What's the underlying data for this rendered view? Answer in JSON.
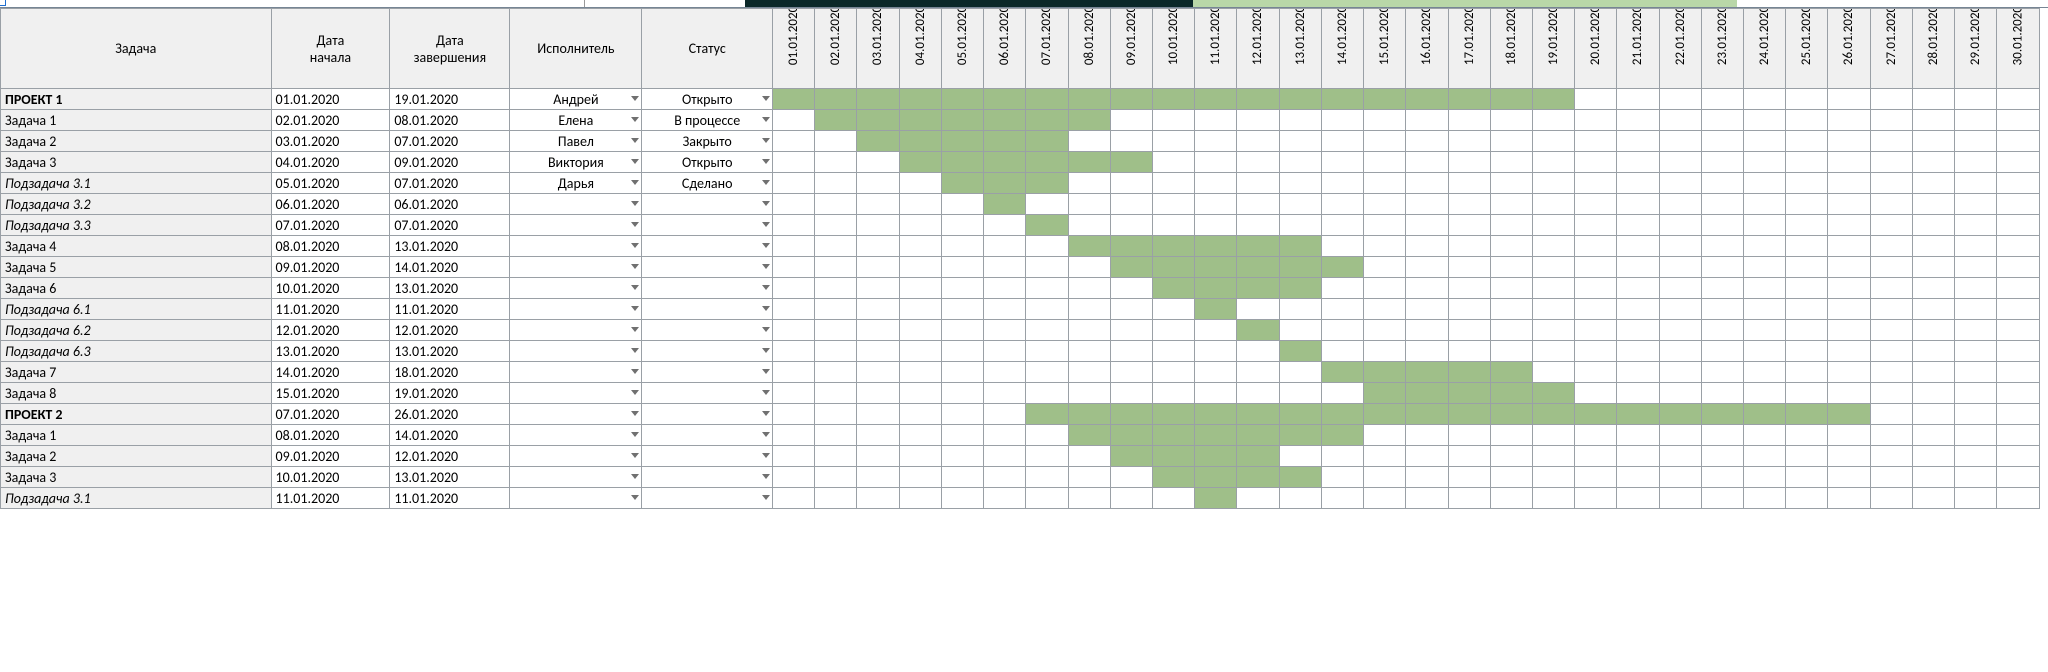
{
  "headers": {
    "task": "Задача",
    "start": "Дата\nначала",
    "end": "Дата\nзавершения",
    "exec": "Исполнитель",
    "status": "Статус"
  },
  "timeline": {
    "start_day": 1,
    "end_day": 30,
    "dates": [
      "01.01.2020",
      "02.01.2020",
      "03.01.2020",
      "04.01.2020",
      "05.01.2020",
      "06.01.2020",
      "07.01.2020",
      "08.01.2020",
      "09.01.2020",
      "10.01.2020",
      "11.01.2020",
      "12.01.2020",
      "13.01.2020",
      "14.01.2020",
      "15.01.2020",
      "16.01.2020",
      "17.01.2020",
      "18.01.2020",
      "19.01.2020",
      "20.01.2020",
      "21.01.2020",
      "22.01.2020",
      "23.01.2020",
      "24.01.2020",
      "25.01.2020",
      "26.01.2020",
      "27.01.2020",
      "28.01.2020",
      "29.01.2020",
      "30.01.2020"
    ]
  },
  "topbar": {
    "dark_from": 6,
    "dark_to": 19,
    "green_from": 20,
    "green_to": 36
  },
  "rows": [
    {
      "task": "ПРОЕКТ 1",
      "style": "proj",
      "start": "01.01.2020",
      "end": "19.01.2020",
      "exec": "Андрей",
      "status": "Открыто",
      "bar": [
        1,
        19
      ]
    },
    {
      "task": "Задача 1",
      "style": "",
      "start": "02.01.2020",
      "end": "08.01.2020",
      "exec": "Елена",
      "status": "В процессе",
      "bar": [
        2,
        8
      ]
    },
    {
      "task": "Задача 2",
      "style": "",
      "start": "03.01.2020",
      "end": "07.01.2020",
      "exec": "Павел",
      "status": "Закрыто",
      "bar": [
        3,
        7
      ]
    },
    {
      "task": "Задача 3",
      "style": "",
      "start": "04.01.2020",
      "end": "09.01.2020",
      "exec": "Виктория",
      "status": "Открыто",
      "bar": [
        4,
        9
      ]
    },
    {
      "task": "Подзадача 3.1",
      "style": "sub",
      "start": "05.01.2020",
      "end": "07.01.2020",
      "exec": "Дарья",
      "status": "Сделано",
      "bar": [
        5,
        7
      ]
    },
    {
      "task": "Подзадача 3.2",
      "style": "sub",
      "start": "06.01.2020",
      "end": "06.01.2020",
      "exec": "",
      "status": "",
      "bar": [
        6,
        6
      ]
    },
    {
      "task": "Подзадача 3.3",
      "style": "sub",
      "start": "07.01.2020",
      "end": "07.01.2020",
      "exec": "",
      "status": "",
      "bar": [
        7,
        7
      ]
    },
    {
      "task": "Задача 4",
      "style": "",
      "start": "08.01.2020",
      "end": "13.01.2020",
      "exec": "",
      "status": "",
      "bar": [
        8,
        13
      ]
    },
    {
      "task": "Задача 5",
      "style": "",
      "start": "09.01.2020",
      "end": "14.01.2020",
      "exec": "",
      "status": "",
      "bar": [
        9,
        14
      ]
    },
    {
      "task": "Задача 6",
      "style": "",
      "start": "10.01.2020",
      "end": "13.01.2020",
      "exec": "",
      "status": "",
      "bar": [
        10,
        13
      ]
    },
    {
      "task": "Подзадача 6.1",
      "style": "sub",
      "start": "11.01.2020",
      "end": "11.01.2020",
      "exec": "",
      "status": "",
      "bar": [
        11,
        11
      ]
    },
    {
      "task": "Подзадача 6.2",
      "style": "sub",
      "start": "12.01.2020",
      "end": "12.01.2020",
      "exec": "",
      "status": "",
      "bar": [
        12,
        12
      ]
    },
    {
      "task": "Подзадача 6.3",
      "style": "sub",
      "start": "13.01.2020",
      "end": "13.01.2020",
      "exec": "",
      "status": "",
      "bar": [
        13,
        13
      ]
    },
    {
      "task": "Задача 7",
      "style": "",
      "start": "14.01.2020",
      "end": "18.01.2020",
      "exec": "",
      "status": "",
      "bar": [
        14,
        18
      ]
    },
    {
      "task": "Задача 8",
      "style": "",
      "start": "15.01.2020",
      "end": "19.01.2020",
      "exec": "",
      "status": "",
      "bar": [
        15,
        19
      ]
    },
    {
      "task": "ПРОЕКТ 2",
      "style": "proj",
      "start": "07.01.2020",
      "end": "26.01.2020",
      "exec": "",
      "status": "",
      "bar": [
        7,
        26
      ]
    },
    {
      "task": "Задача 1",
      "style": "",
      "start": "08.01.2020",
      "end": "14.01.2020",
      "exec": "",
      "status": "",
      "bar": [
        8,
        14
      ]
    },
    {
      "task": "Задача 2",
      "style": "",
      "start": "09.01.2020",
      "end": "12.01.2020",
      "exec": "",
      "status": "",
      "bar": [
        9,
        12
      ]
    },
    {
      "task": "Задача 3",
      "style": "",
      "start": "10.01.2020",
      "end": "13.01.2020",
      "exec": "",
      "status": "",
      "bar": [
        10,
        13
      ]
    },
    {
      "task": "Подзадача 3.1",
      "style": "sub",
      "start": "11.01.2020",
      "end": "11.01.2020",
      "exec": "",
      "status": "",
      "bar": [
        11,
        11
      ]
    }
  ],
  "chart_data": {
    "type": "bar",
    "title": "",
    "xlabel": "Дата",
    "ylabel": "Задача",
    "x_range": [
      "01.01.2020",
      "30.01.2020"
    ],
    "series": [
      {
        "name": "ПРОЕКТ 1",
        "start": "01.01.2020",
        "end": "19.01.2020"
      },
      {
        "name": "Задача 1",
        "start": "02.01.2020",
        "end": "08.01.2020"
      },
      {
        "name": "Задача 2",
        "start": "03.01.2020",
        "end": "07.01.2020"
      },
      {
        "name": "Задача 3",
        "start": "04.01.2020",
        "end": "09.01.2020"
      },
      {
        "name": "Подзадача 3.1",
        "start": "05.01.2020",
        "end": "07.01.2020"
      },
      {
        "name": "Подзадача 3.2",
        "start": "06.01.2020",
        "end": "06.01.2020"
      },
      {
        "name": "Подзадача 3.3",
        "start": "07.01.2020",
        "end": "07.01.2020"
      },
      {
        "name": "Задача 4",
        "start": "08.01.2020",
        "end": "13.01.2020"
      },
      {
        "name": "Задача 5",
        "start": "09.01.2020",
        "end": "14.01.2020"
      },
      {
        "name": "Задача 6",
        "start": "10.01.2020",
        "end": "13.01.2020"
      },
      {
        "name": "Подзадача 6.1",
        "start": "11.01.2020",
        "end": "11.01.2020"
      },
      {
        "name": "Подзадача 6.2",
        "start": "12.01.2020",
        "end": "12.01.2020"
      },
      {
        "name": "Подзадача 6.3",
        "start": "13.01.2020",
        "end": "13.01.2020"
      },
      {
        "name": "Задача 7",
        "start": "14.01.2020",
        "end": "18.01.2020"
      },
      {
        "name": "Задача 8",
        "start": "15.01.2020",
        "end": "19.01.2020"
      },
      {
        "name": "ПРОЕКТ 2",
        "start": "07.01.2020",
        "end": "26.01.2020"
      },
      {
        "name": "Задача 1 (P2)",
        "start": "08.01.2020",
        "end": "14.01.2020"
      },
      {
        "name": "Задача 2 (P2)",
        "start": "09.01.2020",
        "end": "12.01.2020"
      },
      {
        "name": "Задача 3 (P2)",
        "start": "10.01.2020",
        "end": "13.01.2020"
      },
      {
        "name": "Подзадача 3.1 (P2)",
        "start": "11.01.2020",
        "end": "11.01.2020"
      }
    ]
  }
}
